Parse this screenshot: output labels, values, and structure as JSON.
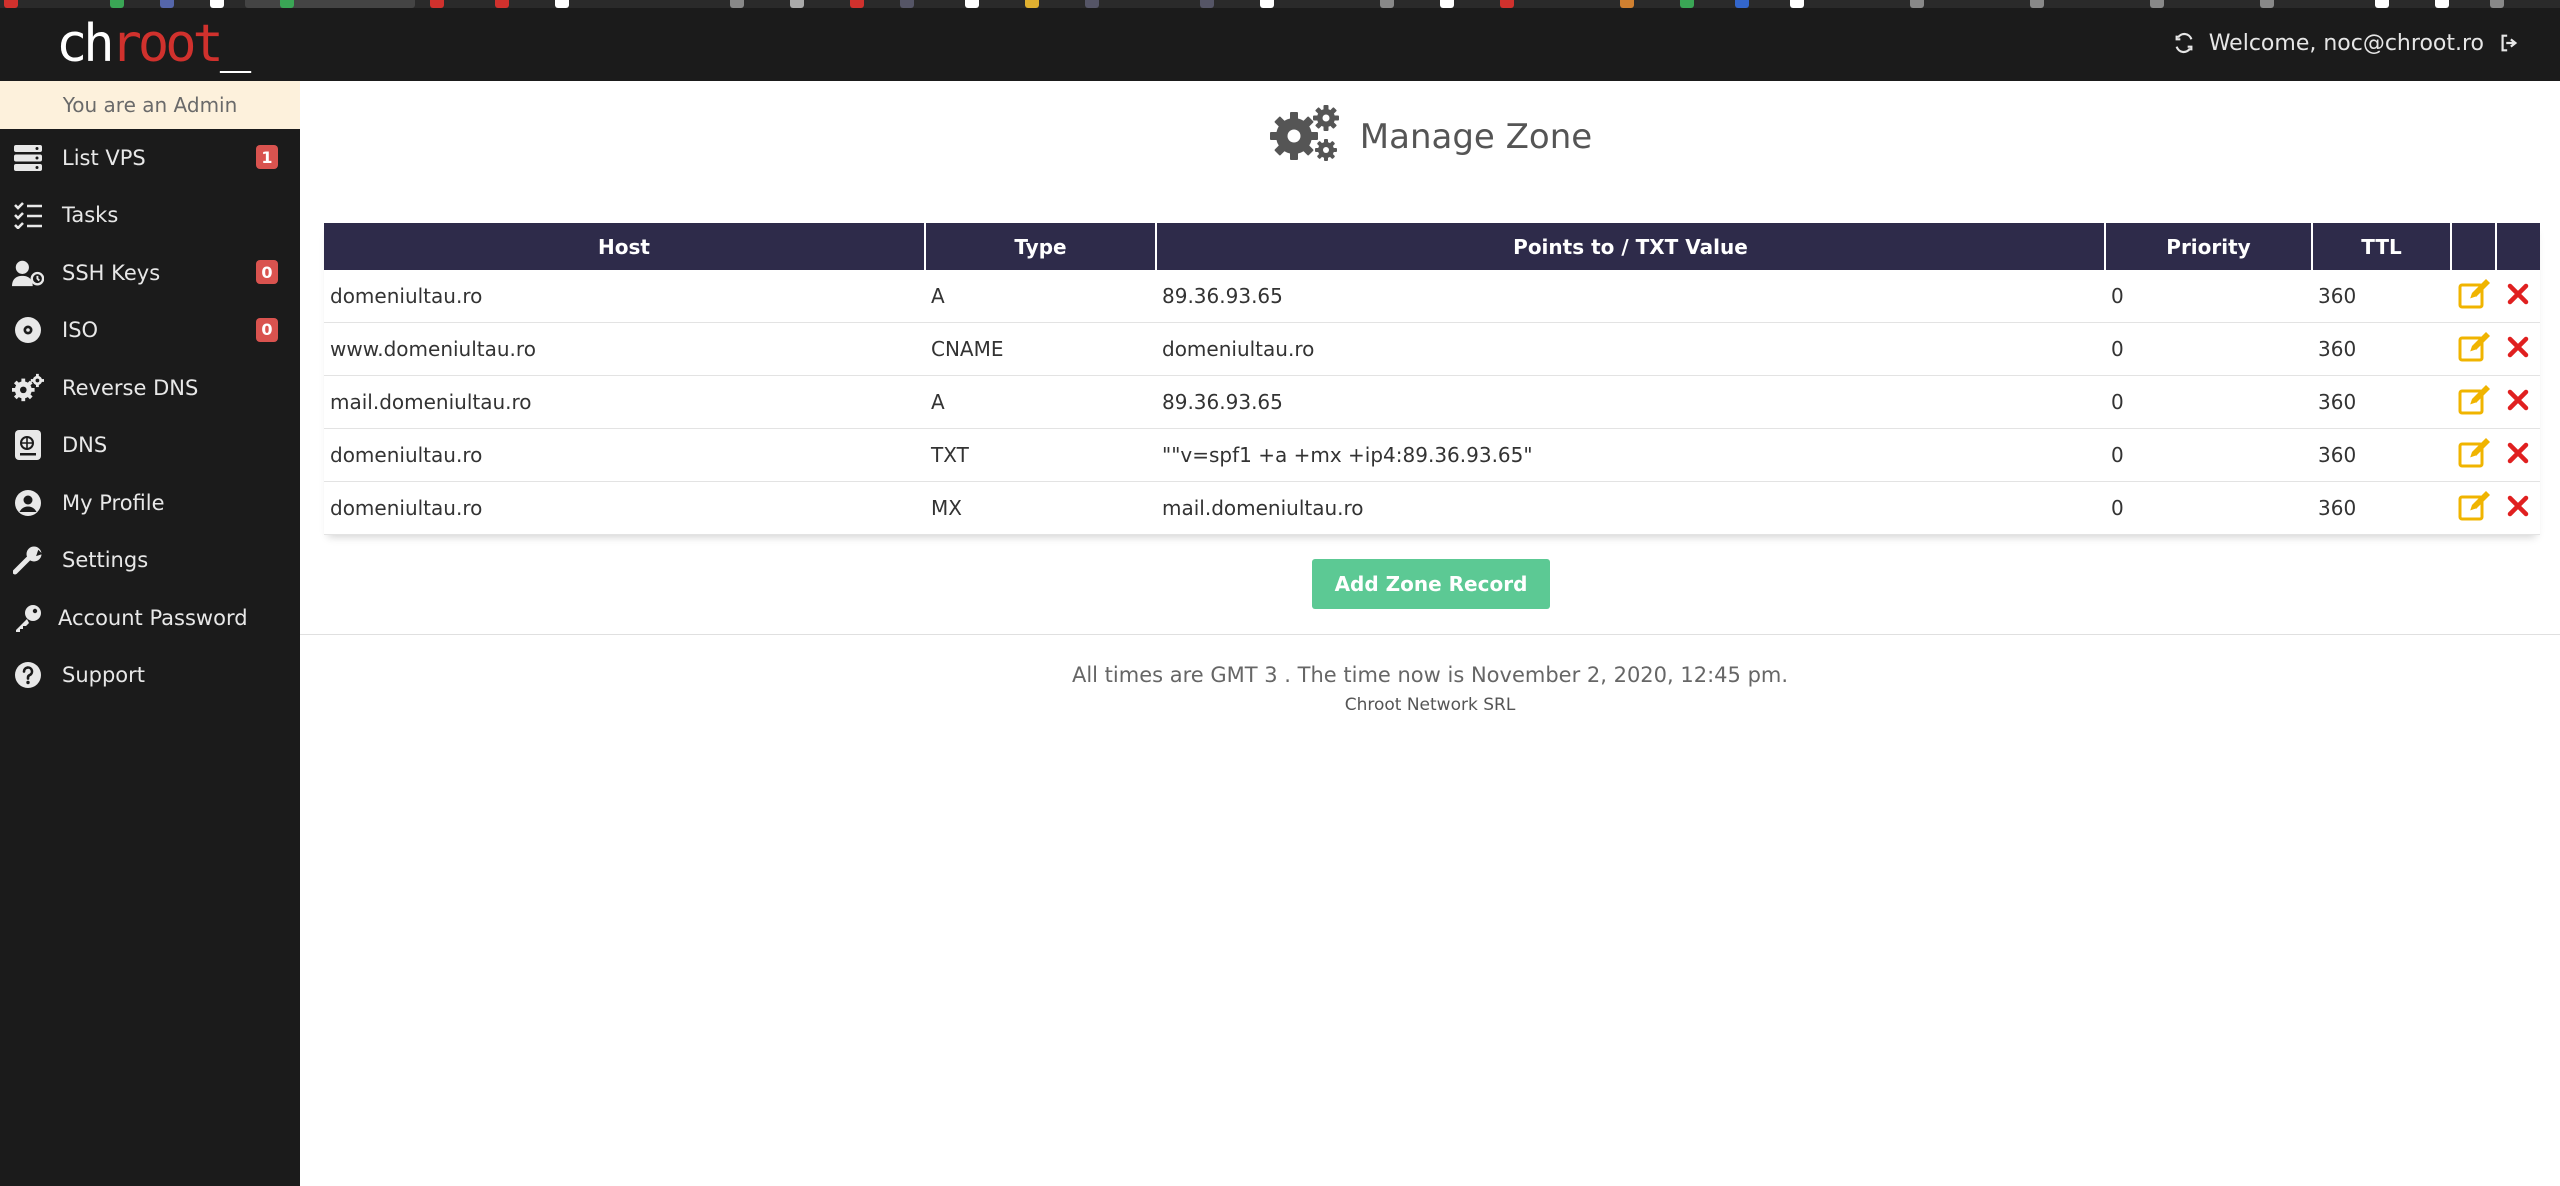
{
  "brand": {
    "logo_part1": "ch",
    "logo_part2": "root",
    "logo_part3": "_"
  },
  "header": {
    "welcome_text": "Welcome, noc@chroot.ro"
  },
  "sidebar": {
    "admin_banner": "You are an Admin",
    "items": [
      {
        "label": "List VPS",
        "icon": "server-icon",
        "badge": "1"
      },
      {
        "label": "Tasks",
        "icon": "tasks-icon"
      },
      {
        "label": "SSH Keys",
        "icon": "user-key-icon",
        "badge": "0"
      },
      {
        "label": "ISO",
        "icon": "disc-icon",
        "badge": "0"
      },
      {
        "label": "Reverse DNS",
        "icon": "gears-icon"
      },
      {
        "label": "DNS",
        "icon": "dns-icon"
      },
      {
        "label": "My Profile",
        "icon": "user-circle-icon"
      },
      {
        "label": "Settings",
        "icon": "wrench-icon"
      },
      {
        "label": "Account Password",
        "icon": "key-icon"
      },
      {
        "label": "Support",
        "icon": "question-circle-icon"
      }
    ]
  },
  "main": {
    "title": "Manage Zone",
    "table": {
      "headers": [
        "Host",
        "Type",
        "Points to / TXT Value",
        "Priority",
        "TTL",
        "",
        ""
      ],
      "rows": [
        {
          "host": "domeniultau.ro",
          "type": "A",
          "value": "89.36.93.65",
          "priority": "0",
          "ttl": "360"
        },
        {
          "host": "www.domeniultau.ro",
          "type": "CNAME",
          "value": "domeniultau.ro",
          "priority": "0",
          "ttl": "360"
        },
        {
          "host": "mail.domeniultau.ro",
          "type": "A",
          "value": "89.36.93.65",
          "priority": "0",
          "ttl": "360"
        },
        {
          "host": "domeniultau.ro",
          "type": "TXT",
          "value": "\"\"v=spf1 +a +mx +ip4:89.36.93.65\"",
          "priority": "0",
          "ttl": "360"
        },
        {
          "host": "domeniultau.ro",
          "type": "MX",
          "value": "mail.domeniultau.ro",
          "priority": "0",
          "ttl": "360"
        }
      ]
    },
    "add_button": "Add Zone Record"
  },
  "footer": {
    "time_text": "All times are GMT 3 . The time now is November 2, 2020, 12:45 pm.",
    "company": "Chroot Network SRL"
  },
  "colors": {
    "sidebar_bg": "#1b1b1b",
    "header_bg": "#2e2b4a",
    "accent_green": "#5cc994",
    "badge_red": "#d9534f",
    "edit_orange": "#f0b400",
    "delete_red": "#e02020"
  }
}
